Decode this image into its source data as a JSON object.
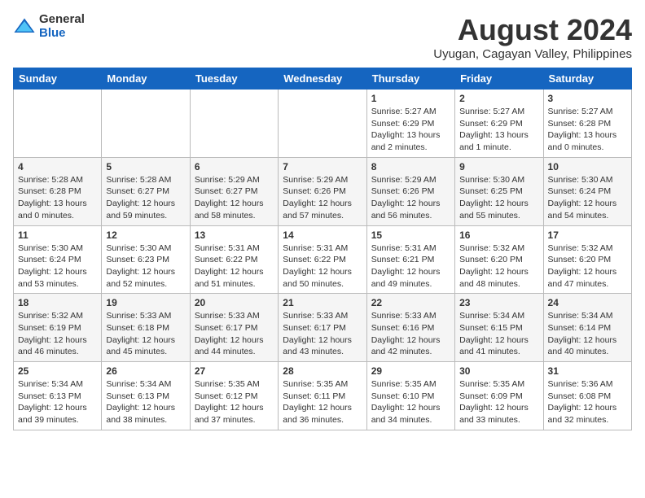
{
  "logo": {
    "general": "General",
    "blue": "Blue"
  },
  "title": {
    "month_year": "August 2024",
    "location": "Uyugan, Cagayan Valley, Philippines"
  },
  "days_of_week": [
    "Sunday",
    "Monday",
    "Tuesday",
    "Wednesday",
    "Thursday",
    "Friday",
    "Saturday"
  ],
  "weeks": [
    [
      {
        "day": "",
        "info": ""
      },
      {
        "day": "",
        "info": ""
      },
      {
        "day": "",
        "info": ""
      },
      {
        "day": "",
        "info": ""
      },
      {
        "day": "1",
        "info": "Sunrise: 5:27 AM\nSunset: 6:29 PM\nDaylight: 13 hours\nand 2 minutes."
      },
      {
        "day": "2",
        "info": "Sunrise: 5:27 AM\nSunset: 6:29 PM\nDaylight: 13 hours\nand 1 minute."
      },
      {
        "day": "3",
        "info": "Sunrise: 5:27 AM\nSunset: 6:28 PM\nDaylight: 13 hours\nand 0 minutes."
      }
    ],
    [
      {
        "day": "4",
        "info": "Sunrise: 5:28 AM\nSunset: 6:28 PM\nDaylight: 13 hours\nand 0 minutes."
      },
      {
        "day": "5",
        "info": "Sunrise: 5:28 AM\nSunset: 6:27 PM\nDaylight: 12 hours\nand 59 minutes."
      },
      {
        "day": "6",
        "info": "Sunrise: 5:29 AM\nSunset: 6:27 PM\nDaylight: 12 hours\nand 58 minutes."
      },
      {
        "day": "7",
        "info": "Sunrise: 5:29 AM\nSunset: 6:26 PM\nDaylight: 12 hours\nand 57 minutes."
      },
      {
        "day": "8",
        "info": "Sunrise: 5:29 AM\nSunset: 6:26 PM\nDaylight: 12 hours\nand 56 minutes."
      },
      {
        "day": "9",
        "info": "Sunrise: 5:30 AM\nSunset: 6:25 PM\nDaylight: 12 hours\nand 55 minutes."
      },
      {
        "day": "10",
        "info": "Sunrise: 5:30 AM\nSunset: 6:24 PM\nDaylight: 12 hours\nand 54 minutes."
      }
    ],
    [
      {
        "day": "11",
        "info": "Sunrise: 5:30 AM\nSunset: 6:24 PM\nDaylight: 12 hours\nand 53 minutes."
      },
      {
        "day": "12",
        "info": "Sunrise: 5:30 AM\nSunset: 6:23 PM\nDaylight: 12 hours\nand 52 minutes."
      },
      {
        "day": "13",
        "info": "Sunrise: 5:31 AM\nSunset: 6:22 PM\nDaylight: 12 hours\nand 51 minutes."
      },
      {
        "day": "14",
        "info": "Sunrise: 5:31 AM\nSunset: 6:22 PM\nDaylight: 12 hours\nand 50 minutes."
      },
      {
        "day": "15",
        "info": "Sunrise: 5:31 AM\nSunset: 6:21 PM\nDaylight: 12 hours\nand 49 minutes."
      },
      {
        "day": "16",
        "info": "Sunrise: 5:32 AM\nSunset: 6:20 PM\nDaylight: 12 hours\nand 48 minutes."
      },
      {
        "day": "17",
        "info": "Sunrise: 5:32 AM\nSunset: 6:20 PM\nDaylight: 12 hours\nand 47 minutes."
      }
    ],
    [
      {
        "day": "18",
        "info": "Sunrise: 5:32 AM\nSunset: 6:19 PM\nDaylight: 12 hours\nand 46 minutes."
      },
      {
        "day": "19",
        "info": "Sunrise: 5:33 AM\nSunset: 6:18 PM\nDaylight: 12 hours\nand 45 minutes."
      },
      {
        "day": "20",
        "info": "Sunrise: 5:33 AM\nSunset: 6:17 PM\nDaylight: 12 hours\nand 44 minutes."
      },
      {
        "day": "21",
        "info": "Sunrise: 5:33 AM\nSunset: 6:17 PM\nDaylight: 12 hours\nand 43 minutes."
      },
      {
        "day": "22",
        "info": "Sunrise: 5:33 AM\nSunset: 6:16 PM\nDaylight: 12 hours\nand 42 minutes."
      },
      {
        "day": "23",
        "info": "Sunrise: 5:34 AM\nSunset: 6:15 PM\nDaylight: 12 hours\nand 41 minutes."
      },
      {
        "day": "24",
        "info": "Sunrise: 5:34 AM\nSunset: 6:14 PM\nDaylight: 12 hours\nand 40 minutes."
      }
    ],
    [
      {
        "day": "25",
        "info": "Sunrise: 5:34 AM\nSunset: 6:13 PM\nDaylight: 12 hours\nand 39 minutes."
      },
      {
        "day": "26",
        "info": "Sunrise: 5:34 AM\nSunset: 6:13 PM\nDaylight: 12 hours\nand 38 minutes."
      },
      {
        "day": "27",
        "info": "Sunrise: 5:35 AM\nSunset: 6:12 PM\nDaylight: 12 hours\nand 37 minutes."
      },
      {
        "day": "28",
        "info": "Sunrise: 5:35 AM\nSunset: 6:11 PM\nDaylight: 12 hours\nand 36 minutes."
      },
      {
        "day": "29",
        "info": "Sunrise: 5:35 AM\nSunset: 6:10 PM\nDaylight: 12 hours\nand 34 minutes."
      },
      {
        "day": "30",
        "info": "Sunrise: 5:35 AM\nSunset: 6:09 PM\nDaylight: 12 hours\nand 33 minutes."
      },
      {
        "day": "31",
        "info": "Sunrise: 5:36 AM\nSunset: 6:08 PM\nDaylight: 12 hours\nand 32 minutes."
      }
    ]
  ]
}
